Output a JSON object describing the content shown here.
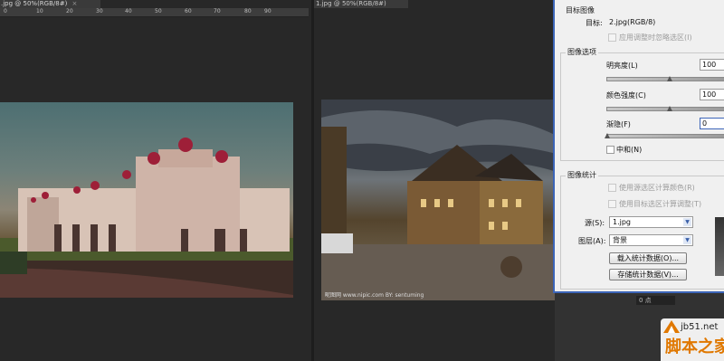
{
  "left_doc": {
    "tab_title": ".jpg @ 50%(RGB/8#)",
    "close_glyph": "×",
    "ruler_ticks": [
      "0",
      "10",
      "20",
      "30",
      "40",
      "50",
      "60",
      "70",
      "80",
      "90"
    ]
  },
  "right_doc": {
    "tab_title": "1.jpg @ 50%(RGB/8#)",
    "watermark": "昵图网 www.nipic.com  BY: sentuming"
  },
  "dialog": {
    "target_group": "目标图像",
    "target_label": "目标:",
    "target_value": "2.jpg(RGB/8)",
    "apply_adjust_label": "应用调整时忽略选区(I)",
    "options_group": "图像选项",
    "luminance_label": "明亮度(L)",
    "luminance_value": "100",
    "color_intensity_label": "颜色强度(C)",
    "color_intensity_value": "100",
    "fade_label": "渐隐(F)",
    "fade_value": "0",
    "neutralize_label": "中和(N)",
    "stats_group": "图像统计",
    "use_source_sel_label": "使用源选区计算颜色(R)",
    "use_target_sel_label": "使用目标选区计算调整(T)",
    "source_label": "源(S):",
    "source_value": "1.jpg",
    "layer_label": "图层(A):",
    "layer_value": "背景",
    "load_stats_button": "载入统计数据(O)...",
    "save_stats_button": "存储统计数据(V)..."
  },
  "panel_bottom": {
    "field_value": "0 点"
  },
  "site_watermark": {
    "url": "jb51.net",
    "name": "脚本之家"
  },
  "colors": {
    "dialog_border": "#3c65b8",
    "workspace_bg": "#282828",
    "watermark_orange": "#e07800"
  }
}
